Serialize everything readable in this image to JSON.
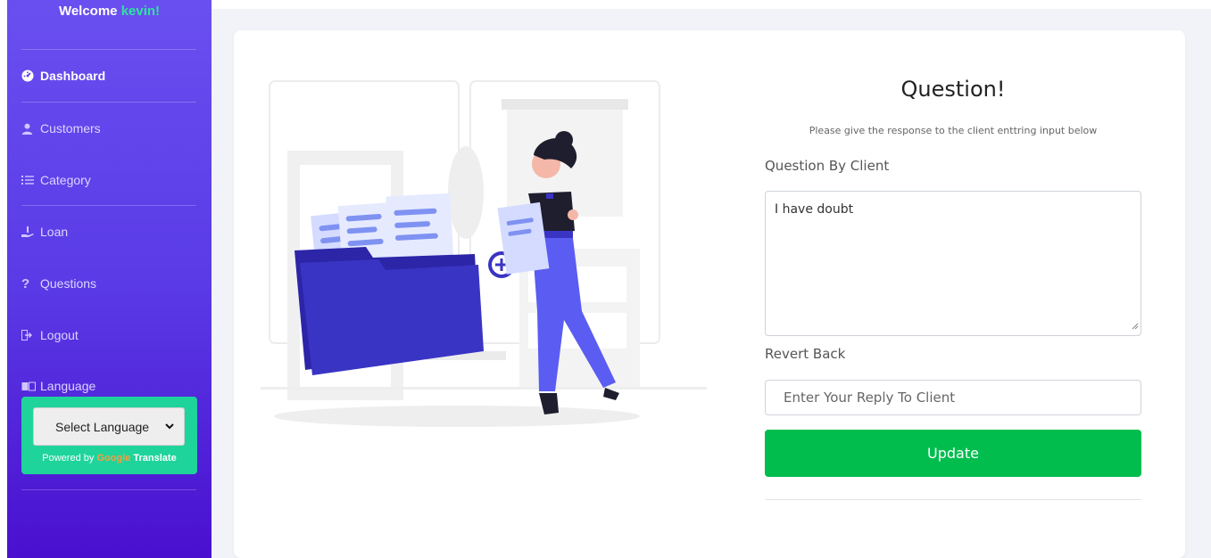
{
  "sidebar": {
    "welcome_prefix": "Welcome ",
    "welcome_user": "kevin!",
    "items": [
      {
        "label": "Dashboard",
        "icon": "dashboard-icon"
      },
      {
        "label": "Customers",
        "icon": "user-icon"
      },
      {
        "label": "Category",
        "icon": "list-icon"
      },
      {
        "label": "Loan",
        "icon": "hand-holding-icon"
      },
      {
        "label": "Questions",
        "icon": "question-icon"
      },
      {
        "label": "Logout",
        "icon": "logout-icon"
      },
      {
        "label": "Language",
        "icon": "language-icon"
      }
    ],
    "language_select": "Select Language",
    "powered_by": "Powered by ",
    "google": "Google",
    "translate": "Translate"
  },
  "main": {
    "title": "Question!",
    "subtitle": "Please give the response to the client enttring input below",
    "question_label": "Question By Client",
    "question_value": "I have doubt",
    "revert_label": "Revert Back",
    "reply_placeholder": "Enter Your Reply To Client",
    "update_label": "Update"
  },
  "colors": {
    "sidebar_top": "#6a4ff0",
    "sidebar_bottom": "#4a10cf",
    "accent_green": "#00bd4e",
    "user_green": "#2ee59d",
    "folder_blue": "#3a34c4"
  }
}
